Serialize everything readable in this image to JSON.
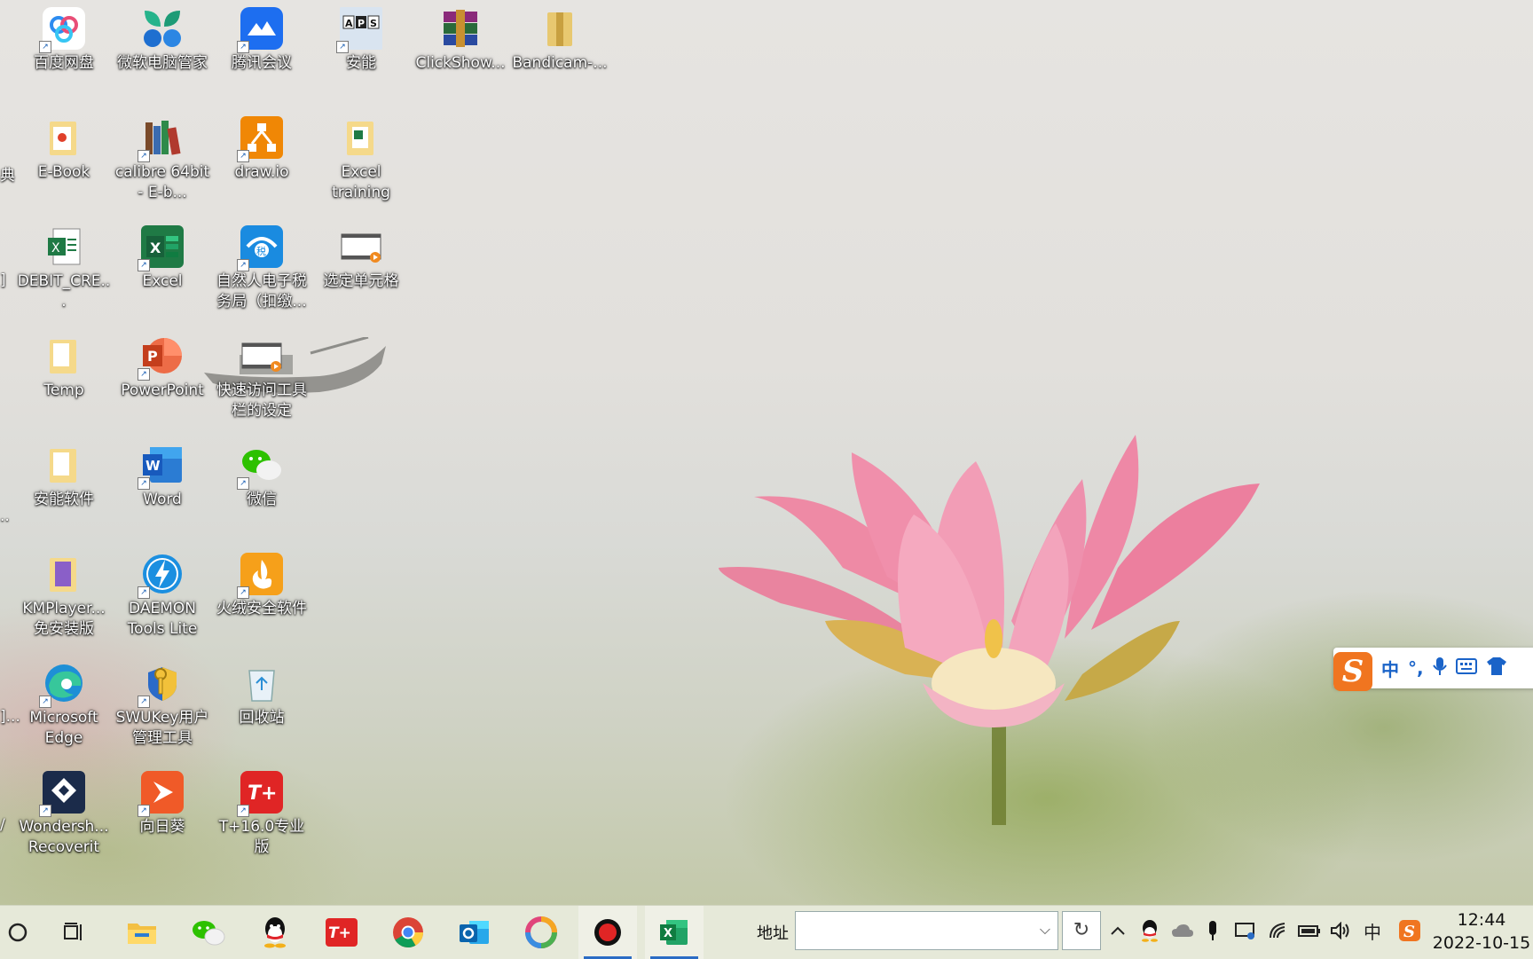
{
  "desktop_icons": {
    "baidu": "百度网盘",
    "pcmanager": "微软电脑管家",
    "tencent_meeting": "腾讯会议",
    "anneng": "安能",
    "clickshow": "ClickShow...",
    "bandicam": "Bandicam-...",
    "ebook": "E-Book",
    "calibre": "calibre 64bit - E-b...",
    "drawio": "draw.io",
    "excel_training": "Excel training",
    "debit": "DEBIT_CRE...",
    "excel": "Excel",
    "tax": "自然人电子税务局（扣缴...",
    "select_cell": "选定单元格",
    "temp": "Temp",
    "powerpoint": "PowerPoint",
    "quick_access": "快速访问工具栏的设定",
    "anneng_soft": "安能软件",
    "word": "Word",
    "wechat": "微信",
    "kmplayer": "KMPlayer... 免安装版",
    "daemon": "DAEMON Tools Lite",
    "huorong": "火绒安全软件",
    "edge": "Microsoft Edge",
    "swukey": "SWUKey用户管理工具",
    "recycle": "回收站",
    "wondershare": "Wondersh... Recoverit",
    "sunflower": "向日葵",
    "tplus": "T+16.0专业版"
  },
  "edge_fragments": {
    "row2": "典",
    "row3": "]",
    "row5": "..",
    "row7": "]...",
    "row8": "/"
  },
  "ime": {
    "logo": "S",
    "mode": "中",
    "punct": "°,"
  },
  "taskbar": {
    "address_label": "地址",
    "address_value": "",
    "address_placeholder": "",
    "refresh": "↻",
    "dropdown": "⌵"
  },
  "tray": {
    "chevron": "^",
    "ime_lang": "中"
  },
  "clock": {
    "time": "12:44",
    "date": "2022-10-15"
  },
  "colors": {
    "taskbar_bg": "#e6e9d9",
    "active_underline": "#2b6cc4",
    "ime_accent": "#f07520"
  }
}
